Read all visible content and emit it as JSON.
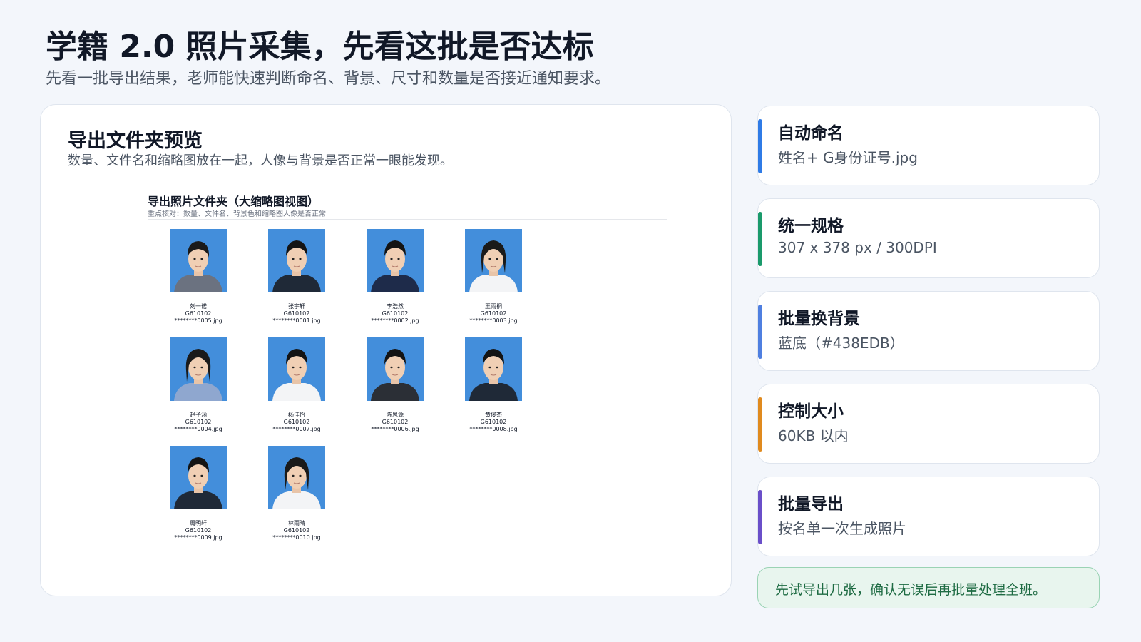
{
  "header": {
    "title": "学籍 2.0 照片采集，先看这批是否达标",
    "subtitle": "先看一批导出结果，老师能快速判断命名、背景、尺寸和数量是否接近通知要求。"
  },
  "preview": {
    "title": "导出文件夹预览",
    "description": "数量、文件名和缩略图放在一起，人像与背景是否正常一眼能发现。",
    "folder_title": "导出照片文件夹（大缩略图视图）",
    "folder_hint": "重点核对：数量、文件名、背景色和缩略图人像是否正常",
    "photos": [
      {
        "name": "刘一诺",
        "code": "G610102",
        "file": "********0005.jpg",
        "shirt": "#6b7280",
        "hair": "long"
      },
      {
        "name": "张宇轩",
        "code": "G610102",
        "file": "********0001.jpg",
        "shirt": "#1f2937",
        "hair": "short"
      },
      {
        "name": "李浩然",
        "code": "G610102",
        "file": "********0002.jpg",
        "shirt": "#1e2b4a",
        "hair": "short"
      },
      {
        "name": "王雨桐",
        "code": "G610102",
        "file": "********0003.jpg",
        "shirt": "#f3f4f6",
        "hair": "girl"
      },
      {
        "name": "赵子涵",
        "code": "G610102",
        "file": "********0004.jpg",
        "shirt": "#8fa7cf",
        "hair": "girl"
      },
      {
        "name": "杨佳怡",
        "code": "G610102",
        "file": "********0007.jpg",
        "shirt": "#f3f4f6",
        "hair": "short"
      },
      {
        "name": "陈思源",
        "code": "G610102",
        "file": "********0006.jpg",
        "shirt": "#2b2f36",
        "hair": "short"
      },
      {
        "name": "黄俊杰",
        "code": "G610102",
        "file": "********0008.jpg",
        "shirt": "#1f2937",
        "hair": "short"
      },
      {
        "name": "周明轩",
        "code": "G610102",
        "file": "********0009.jpg",
        "shirt": "#1f2937",
        "hair": "short"
      },
      {
        "name": "林雨晴",
        "code": "G610102",
        "file": "********0010.jpg",
        "shirt": "#f3f4f6",
        "hair": "girl"
      }
    ],
    "thumb_bg": "#438edb"
  },
  "features": [
    {
      "title": "自动命名",
      "value": "姓名+ G身份证号.jpg",
      "color": "#2f7be6"
    },
    {
      "title": "统一规格",
      "value": "307 x 378 px / 300DPI",
      "color": "#1a9a6b"
    },
    {
      "title": "批量换背景",
      "value": "蓝底（#438EDB）",
      "color": "#4f7fe0"
    },
    {
      "title": "控制大小",
      "value": "60KB 以内",
      "color": "#e08a1e"
    },
    {
      "title": "批量导出",
      "value": "按名单一次生成照片",
      "color": "#6a4fc9"
    }
  ],
  "tip": {
    "text": "先试导出几张，确认无误后再批量处理全班。"
  }
}
